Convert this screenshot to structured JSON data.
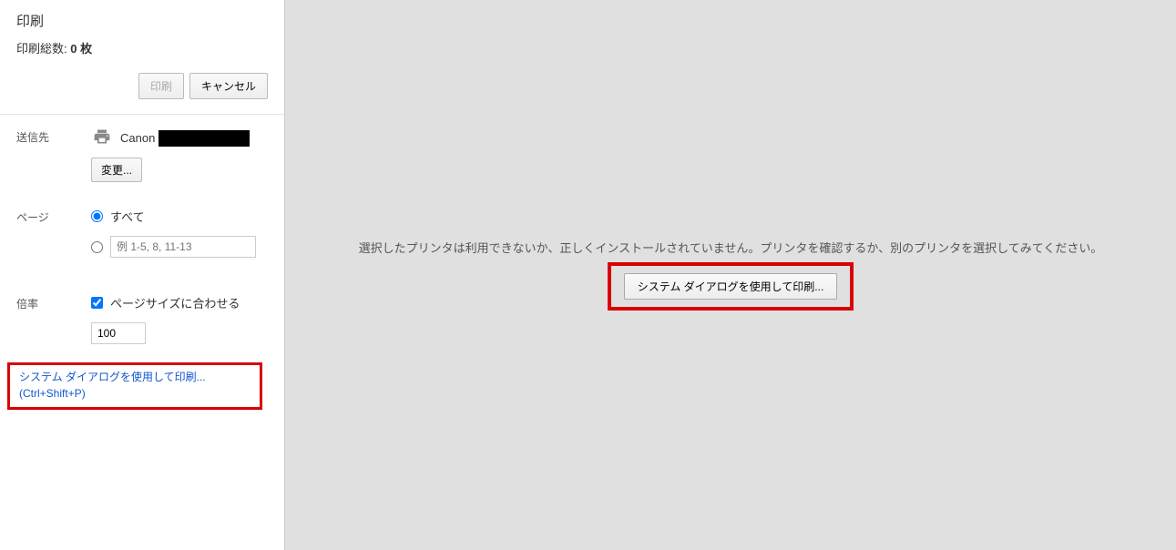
{
  "header": {
    "title": "印刷",
    "subtitle_prefix": "印刷総数: ",
    "subtitle_count": "0 枚"
  },
  "actions": {
    "print_label": "印刷",
    "cancel_label": "キャンセル"
  },
  "destination": {
    "label": "送信先",
    "printer_prefix": "Canon",
    "change_label": "変更..."
  },
  "pages": {
    "label": "ページ",
    "all_label": "すべて",
    "range_placeholder": "例 1-5, 8, 11-13"
  },
  "scale": {
    "label": "倍率",
    "fit_label": "ページサイズに合わせる",
    "value": "100"
  },
  "system_link": {
    "text": "システム ダイアログを使用して印刷...",
    "shortcut": "(Ctrl+Shift+P)"
  },
  "preview": {
    "error": "選択したプリンタは利用できないか、正しくインストールされていません。プリンタを確認するか、別のプリンタを選択してみてください。",
    "sys_button": "システム ダイアログを使用して印刷..."
  }
}
